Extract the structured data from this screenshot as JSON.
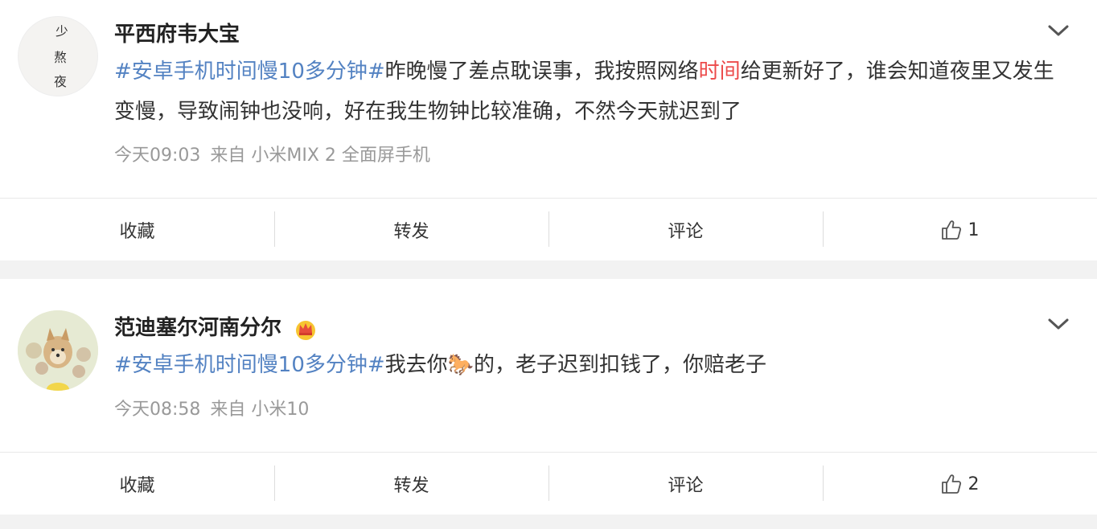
{
  "posts": [
    {
      "author": "平西府韦大宝",
      "hashtag": "#安卓手机时间慢10多分钟#",
      "text_a": "昨晚慢了差点耽误事，我按照网络",
      "text_highlight": "时间",
      "text_b": "给更新好了，谁会知道夜里又发生变慢，导致闹钟也没响，好在我生物钟比较准确，不然今天就迟到了",
      "time": "今天09:03",
      "source": "来自 小米MIX 2 全面屏手机",
      "actions": {
        "favorite": "收藏",
        "repost": "转发",
        "comment": "评论",
        "like_count": "1"
      },
      "avatar_text": [
        "少",
        "熬",
        "夜"
      ]
    },
    {
      "author": "范迪塞尔河南分尔",
      "hashtag": "#安卓手机时间慢10多分钟#",
      "text_a": "我去你",
      "text_emoji": "🐎",
      "text_b": "的，老子迟到扣钱了，你赔老子",
      "time": "今天08:58",
      "source": "来自 小米10",
      "actions": {
        "favorite": "收藏",
        "repost": "转发",
        "comment": "评论",
        "like_count": "2"
      }
    }
  ],
  "colors": {
    "link": "#5382c2",
    "highlight": "#ec4b4b",
    "meta": "#999999",
    "background": "#f2f2f2"
  },
  "icons": {
    "chevron": "chevron-down-icon",
    "like": "thumbs-up-icon",
    "badge": "crown-icon"
  }
}
